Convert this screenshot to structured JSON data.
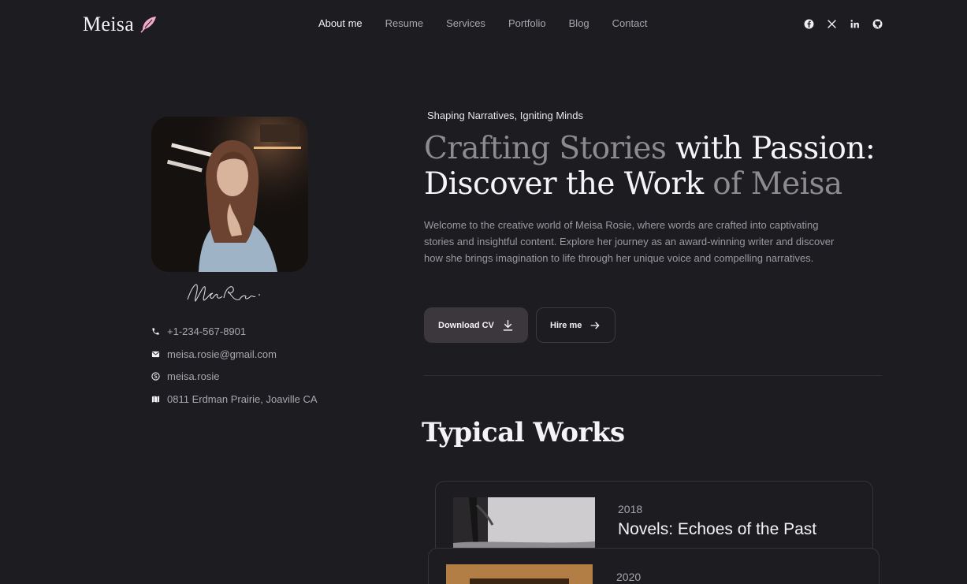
{
  "header": {
    "logo_text": "Meisa",
    "nav": [
      {
        "label": "About me",
        "active": true
      },
      {
        "label": "Resume",
        "active": false
      },
      {
        "label": "Services",
        "active": false
      },
      {
        "label": "Portfolio",
        "active": false
      },
      {
        "label": "Blog",
        "active": false
      },
      {
        "label": "Contact",
        "active": false
      }
    ],
    "socials": [
      "facebook-icon",
      "x-icon",
      "linkedin-icon",
      "github-icon"
    ]
  },
  "profile": {
    "signature": "Meisa Rosie",
    "contacts": [
      {
        "icon": "phone-icon",
        "text": "+1-234-567-8901"
      },
      {
        "icon": "mail-icon",
        "text": "meisa.rosie@gmail.com"
      },
      {
        "icon": "skype-icon",
        "text": "meisa.rosie"
      },
      {
        "icon": "map-icon",
        "text": "0811 Erdman Prairie, Joaville CA"
      }
    ]
  },
  "hero": {
    "tagline": "Shaping Narratives, Igniting Minds",
    "title_part1": "Crafting Stories",
    "title_part2": " with Passion: Discover the Work ",
    "title_part3": "of Meisa",
    "description": "Welcome to the creative world of Meisa Rosie, where words are crafted into captivating stories and insightful content. Explore her journey as an award-winning writer and discover how she brings imagination to life through her unique voice and compelling narratives.",
    "download_label": "Download CV",
    "hire_label": "Hire me"
  },
  "works": {
    "title": "Typical Works",
    "items": [
      {
        "year": "2018",
        "title": "Novels: Echoes of the Past"
      },
      {
        "year": "2020",
        "title": ""
      }
    ]
  },
  "colors": {
    "background": "#1d1c21",
    "accent_feather": "#f3a9c9",
    "muted_text": "#8d8a90"
  }
}
